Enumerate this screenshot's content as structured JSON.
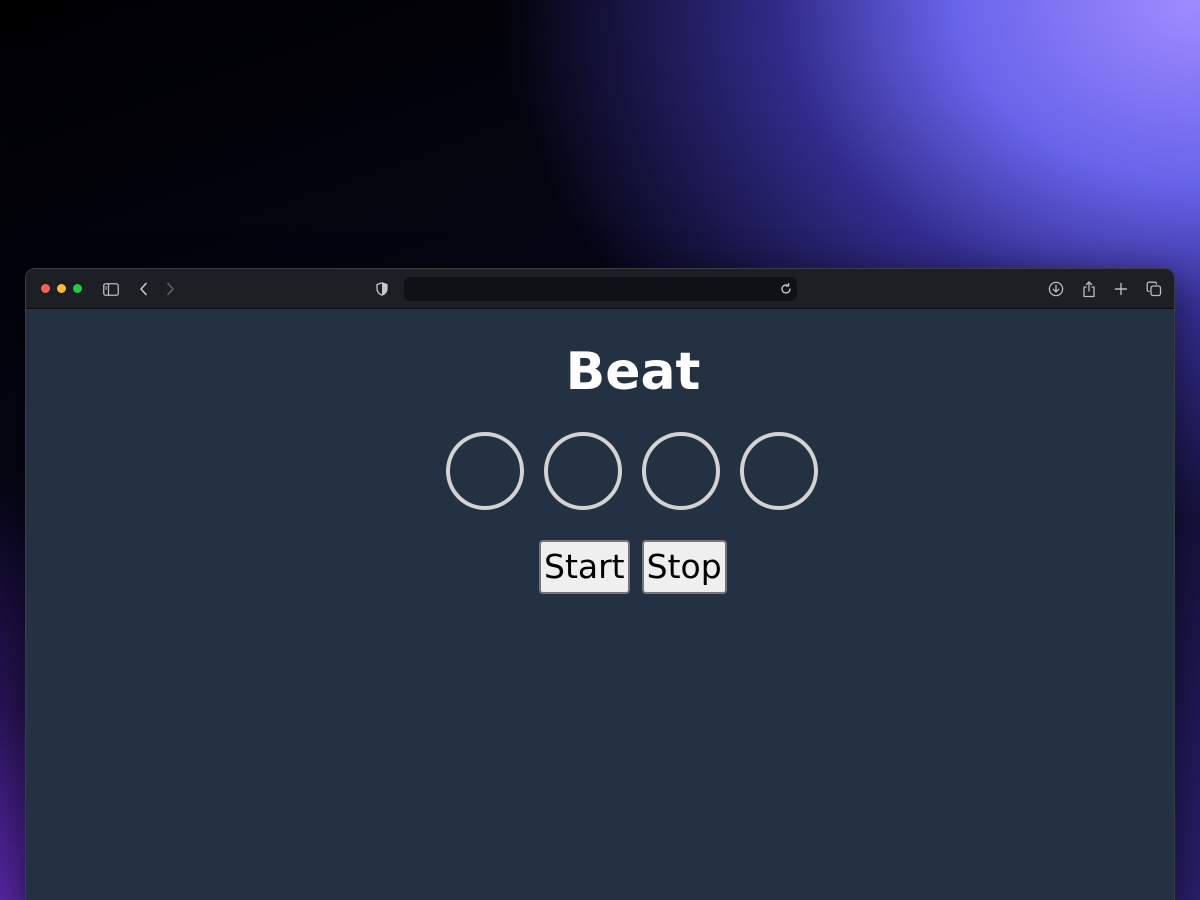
{
  "browser": {
    "address_value": "",
    "traffic_lights": {
      "close_color": "#ff5f57",
      "minimize_color": "#febc2e",
      "zoom_color": "#28c840"
    },
    "toolbar_icons": [
      "sidebar-icon",
      "back-icon",
      "forward-icon",
      "shield-icon",
      "reload-icon",
      "download-icon",
      "share-icon",
      "new-tab-icon",
      "tabs-overview-icon"
    ]
  },
  "page": {
    "title": "Beat",
    "background_color": "#243142",
    "beat_indicator_count": 4,
    "beat_ring_color": "#d3d3d3",
    "buttons": {
      "start_label": "Start",
      "stop_label": "Stop"
    }
  }
}
